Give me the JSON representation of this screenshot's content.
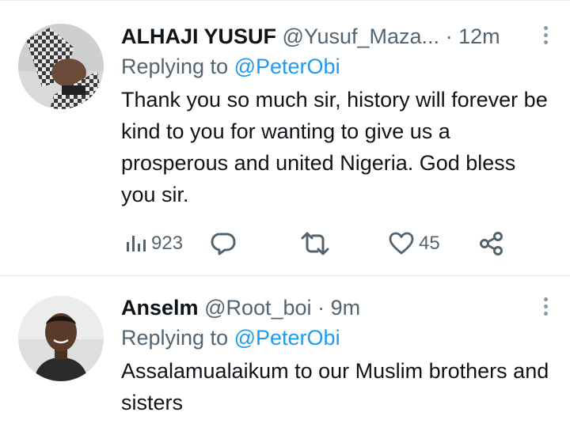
{
  "tweets": [
    {
      "display_name": "ALHAJI YUSUF",
      "handle": "@Yusuf_Maza...",
      "separator": "·",
      "time": "12m",
      "replying_prefix": "Replying to",
      "replying_handle": "@PeterObi",
      "text": "Thank you so much sir, history will forever be kind to you for wanting to give us a prosperous and united Nigeria. God bless you sir.",
      "views": "923",
      "likes": "45"
    },
    {
      "display_name": "Anselm",
      "handle": "@Root_boi",
      "separator": "·",
      "time": "9m",
      "replying_prefix": "Replying to",
      "replying_handle": "@PeterObi",
      "text": "Assalamualaikum to our Muslim brothers and sisters"
    }
  ],
  "colors": {
    "link": "#1d9bf0",
    "muted": "#536471",
    "text": "#0f1419"
  },
  "icons": [
    "views-icon",
    "reply-icon",
    "retweet-icon",
    "like-icon",
    "share-icon",
    "more-icon"
  ]
}
